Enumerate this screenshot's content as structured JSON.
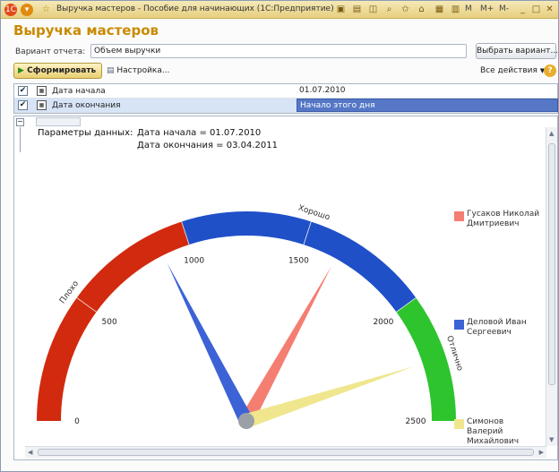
{
  "window": {
    "title": "Выручка мастеров - Пособие для начинающих  (1С:Предприятие)",
    "toolbar_m": "M",
    "toolbar_mplus": "M+",
    "toolbar_mminus": "M-"
  },
  "header": {
    "title": "Выручка мастеров"
  },
  "variant": {
    "label": "Вариант отчета:",
    "value": "Объем выручки",
    "choose_button": "Выбрать вариант..."
  },
  "commands": {
    "generate_button": "Сформировать",
    "settings_button": "Настройка...",
    "all_actions": "Все действия",
    "help": "?"
  },
  "params_grid": [
    {
      "checked": true,
      "name": "Дата начала",
      "value": "01.07.2010"
    },
    {
      "checked": true,
      "name": "Дата окончания",
      "value": "Начало этого дня"
    }
  ],
  "report": {
    "params_label": "Параметры данных:",
    "start_param": "Дата начала = 01.07.2010",
    "end_param": "Дата окончания = 03.04.2011"
  },
  "chart_data": {
    "type": "gauge",
    "min": 0,
    "max": 2500,
    "ticks": [
      0,
      500,
      1000,
      1500,
      2000,
      2500
    ],
    "bands": [
      {
        "label": "Плохо",
        "from": 0,
        "to": 1000,
        "color": "#d22a0e"
      },
      {
        "label": "Хорошо",
        "from": 1000,
        "to": 2000,
        "color": "#1f50c8"
      },
      {
        "label": "Отлично",
        "from": 2000,
        "to": 2500,
        "color": "#2ec42e"
      }
    ],
    "series": [
      {
        "name": "Гусаков Николай\nДмитриевич",
        "value": 1650,
        "color": "#f47e72"
      },
      {
        "name": "Деловой Иван\nСергеевич",
        "value": 880,
        "color": "#3c62d6"
      },
      {
        "name": "Симонов\nВалерий\nМихайлович",
        "value": 2250,
        "color": "#f0e68e"
      }
    ]
  }
}
